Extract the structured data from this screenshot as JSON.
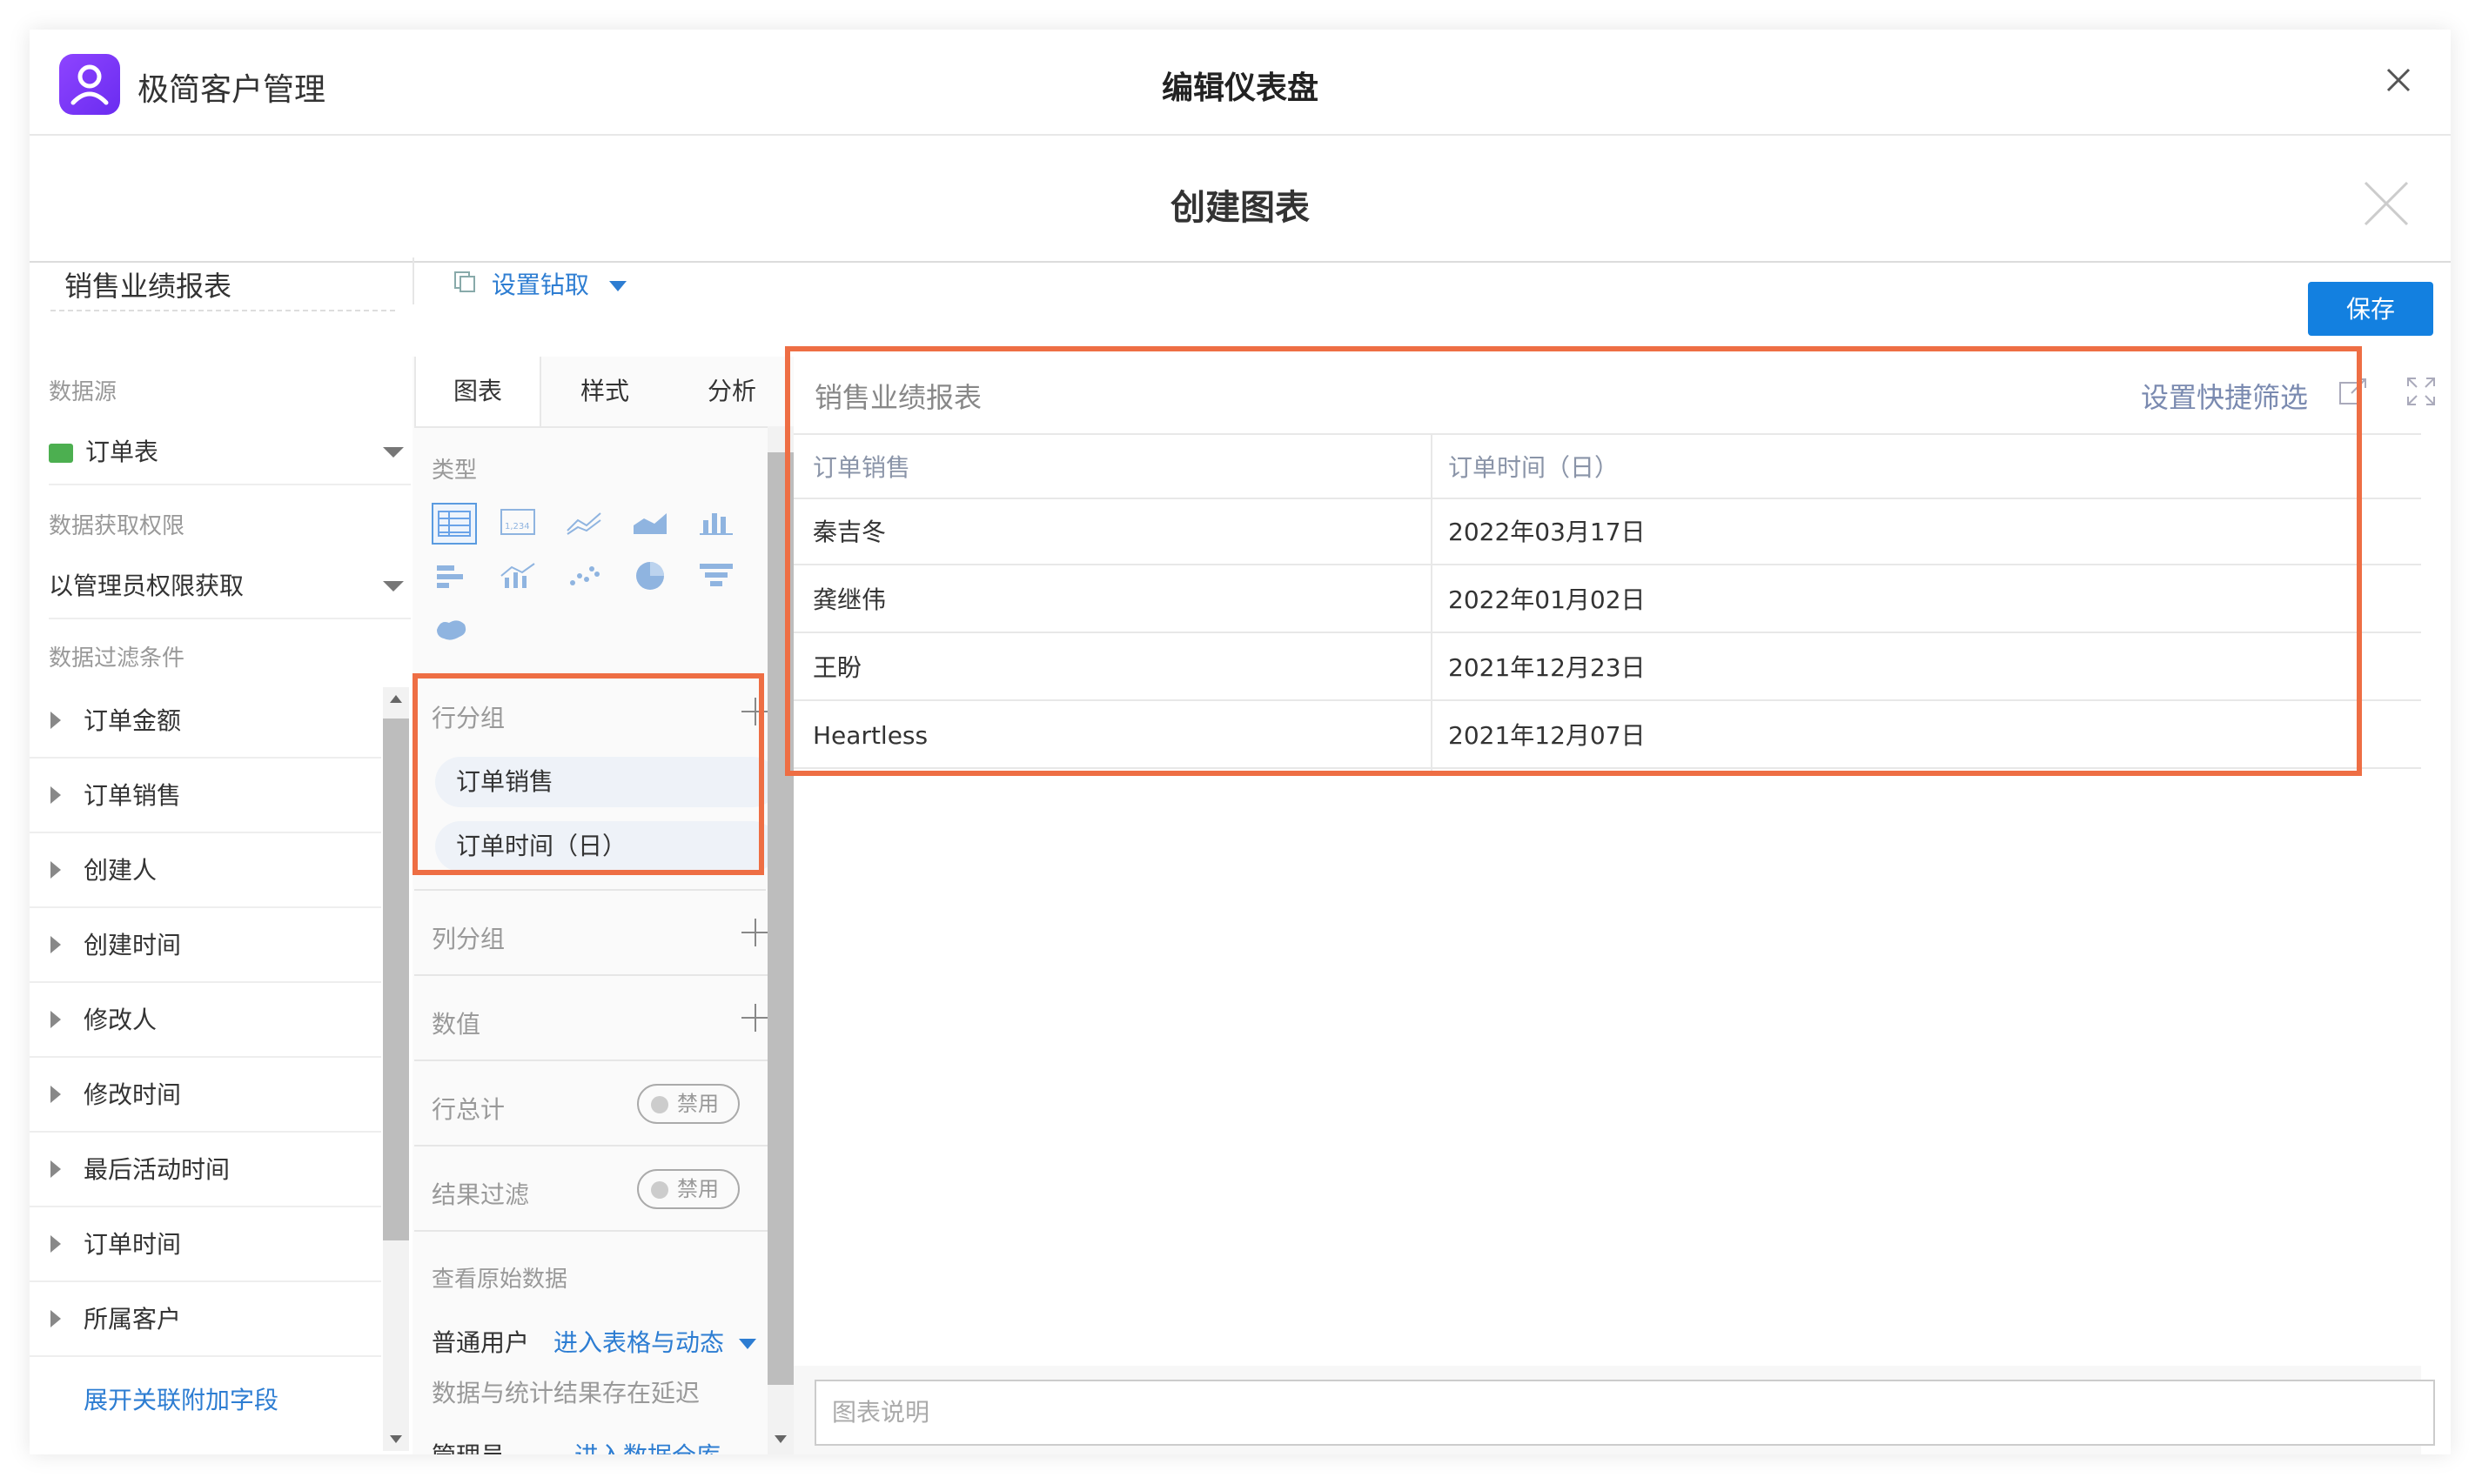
{
  "app": {
    "name": "极简客户管理",
    "window_title": "编辑仪表盘"
  },
  "dialog": {
    "title": "创建图表"
  },
  "toolbar": {
    "chart_name": "销售业绩报表",
    "drill_label": "设置钻取",
    "save_label": "保存"
  },
  "left": {
    "datasource_label": "数据源",
    "datasource_value": "订单表",
    "permission_label": "数据获取权限",
    "permission_value": "以管理员权限获取",
    "filter_label": "数据过滤条件",
    "fields": [
      "订单金额",
      "订单销售",
      "创建人",
      "创建时间",
      "修改人",
      "修改时间",
      "最后活动时间",
      "订单时间",
      "所属客户"
    ],
    "more_link": "展开关联附加字段"
  },
  "mid": {
    "tabs": [
      "图表",
      "样式",
      "分析"
    ],
    "type_label": "类型",
    "row_group_label": "行分组",
    "row_group_items": [
      "订单销售",
      "订单时间（日）"
    ],
    "col_group_label": "列分组",
    "value_label": "数值",
    "row_total_label": "行总计",
    "row_total_state": "禁用",
    "result_filter_label": "结果过滤",
    "result_filter_state": "禁用",
    "raw_data_label": "查看原始数据",
    "normal_user_label": "普通用户",
    "normal_user_link": "进入表格与动态",
    "delay_note": "数据与统计结果存在延迟",
    "admin_label": "管理员",
    "admin_link": "进入数据仓库"
  },
  "preview": {
    "title": "销售业绩报表",
    "quick_filter": "设置快捷筛选",
    "columns": [
      "订单销售",
      "订单时间（日）"
    ],
    "rows": [
      [
        "秦吉冬",
        "2022年03月17日"
      ],
      [
        "龚继伟",
        "2022年01月02日"
      ],
      [
        "王盼",
        "2021年12月23日"
      ],
      [
        "Heartless",
        "2021年12月07日"
      ]
    ],
    "desc_placeholder": "图表说明"
  },
  "colors": {
    "accent": "#1380e0",
    "highlight": "#ee6e44",
    "link": "#2d7dd2",
    "logo": "#7b3cf6"
  },
  "icons": [
    "user-icon",
    "close-icon",
    "drill-icon",
    "caret-down-icon",
    "briefcase-icon",
    "triangle-right-icon",
    "plus-icon",
    "export-icon",
    "fullscreen-icon"
  ]
}
